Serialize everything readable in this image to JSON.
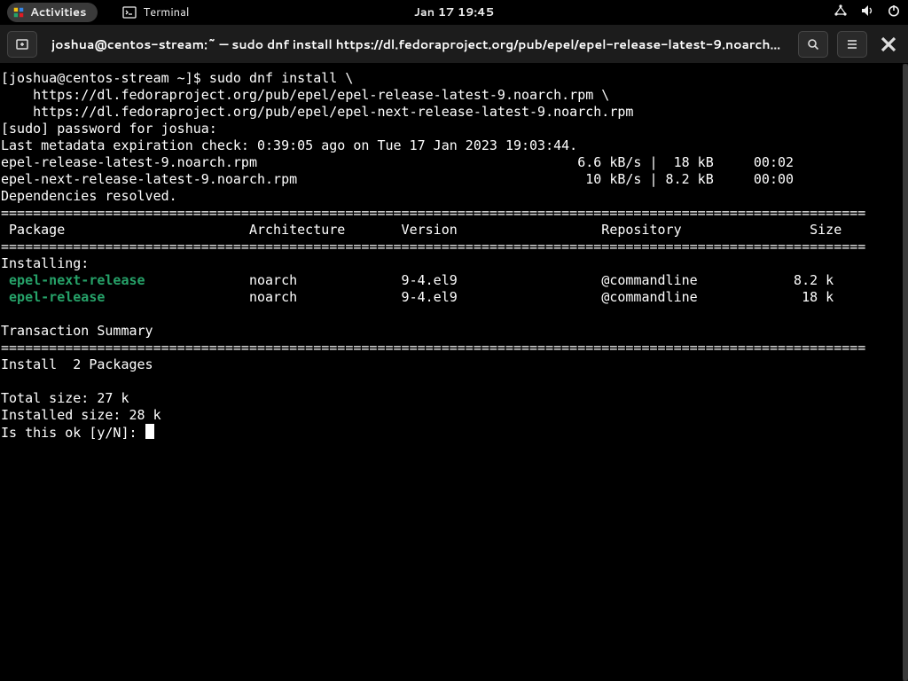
{
  "topbar": {
    "activities_label": "Activities",
    "app_label": "Terminal",
    "clock": "Jan 17  19:45"
  },
  "titlebar": {
    "title": "joshua@centos-stream:~ — sudo dnf install https://dl.fedoraproject.org/pub/epel/epel-release-latest-9.noarch.rpm …"
  },
  "terminal": {
    "prompt": "[joshua@centos-stream ~]$ ",
    "cmd1": "sudo dnf install \\",
    "cmd2": "    https://dl.fedoraproject.org/pub/epel/epel-release-latest-9.noarch.rpm \\",
    "cmd3": "    https://dl.fedoraproject.org/pub/epel/epel-next-release-latest-9.noarch.rpm",
    "sudo_line": "[sudo] password for joshua: ",
    "meta_line": "Last metadata expiration check: 0:39:05 ago on Tue 17 Jan 2023 19:03:44.",
    "dl1": "epel-release-latest-9.noarch.rpm                                        6.6 kB/s |  18 kB     00:02    ",
    "dl2": "epel-next-release-latest-9.noarch.rpm                                    10 kB/s | 8.2 kB     00:00    ",
    "deps": "Dependencies resolved.",
    "rule": "============================================================================================================",
    "hdr": " Package                       Architecture       Version                  Repository                Size",
    "installing": "Installing:",
    "pkg1_name": " epel-next-release",
    "pkg1_rest": "             noarch             9-4.el9                  @commandline            8.2 k",
    "pkg2_name": " epel-release",
    "pkg2_rest": "                  noarch             9-4.el9                  @commandline             18 k",
    "tx_summary": "Transaction Summary",
    "install_count": "Install  2 Packages",
    "total_size": "Total size: 27 k",
    "installed_size": "Installed size: 28 k",
    "confirm": "Is this ok [y/N]: "
  }
}
